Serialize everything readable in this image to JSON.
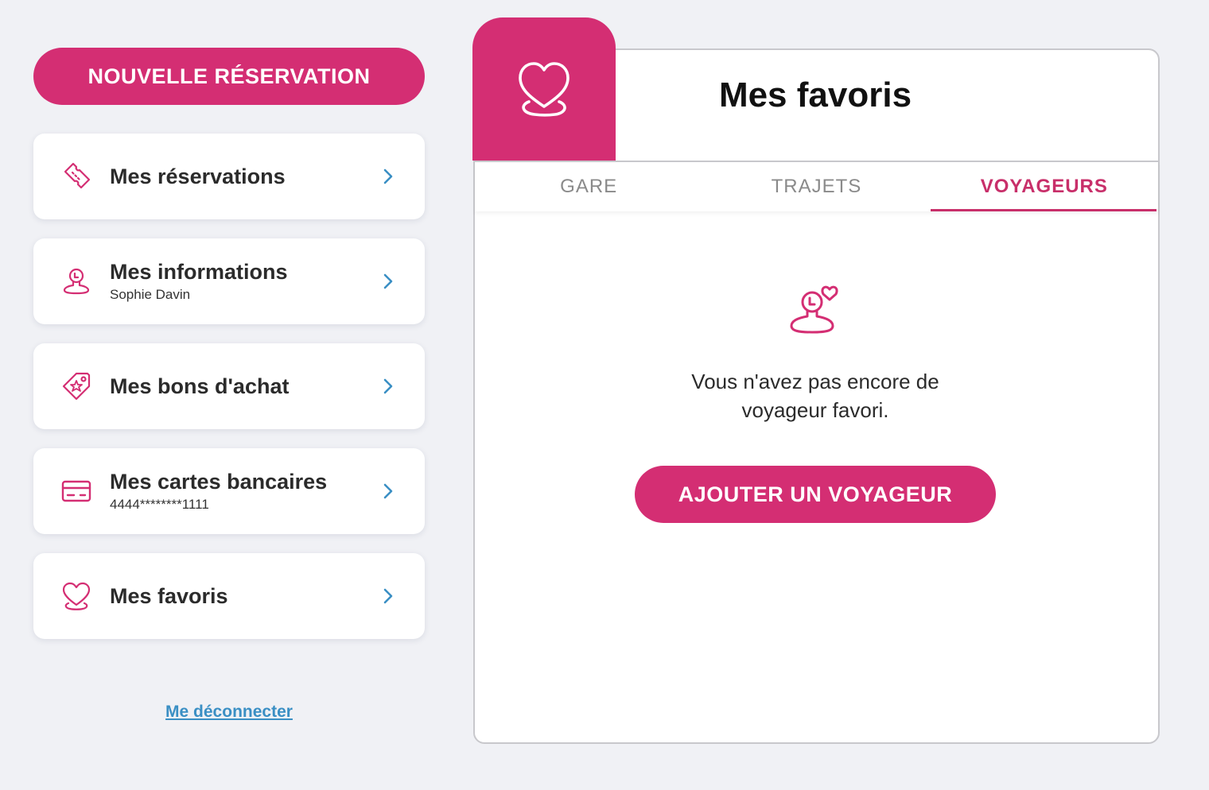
{
  "colors": {
    "brand": "#d42e73",
    "link": "#3a8fc4",
    "background": "#f0f1f5"
  },
  "sidebar": {
    "new_booking_label": "NOUVELLE RÉSERVATION",
    "items": [
      {
        "icon": "ticket-icon",
        "title": "Mes réservations",
        "subtitle": ""
      },
      {
        "icon": "person-icon",
        "title": "Mes informations",
        "subtitle": "Sophie Davin"
      },
      {
        "icon": "voucher-tag-icon",
        "title": "Mes bons d'achat",
        "subtitle": ""
      },
      {
        "icon": "credit-card-icon",
        "title": "Mes cartes bancaires",
        "subtitle": "4444********1111"
      },
      {
        "icon": "heart-pin-icon",
        "title": "Mes favoris",
        "subtitle": ""
      }
    ],
    "logout_label": "Me déconnecter"
  },
  "main": {
    "title": "Mes favoris",
    "badge_icon": "heart-pin-icon",
    "tabs": [
      {
        "label": "GARE",
        "active": false
      },
      {
        "label": "TRAJETS",
        "active": false
      },
      {
        "label": "VOYAGEURS",
        "active": true
      }
    ],
    "empty_state": {
      "icon": "traveler-heart-icon",
      "line1": "Vous n'avez pas encore de",
      "line2": "voyageur favori."
    },
    "add_button_label": "AJOUTER UN VOYAGEUR"
  }
}
